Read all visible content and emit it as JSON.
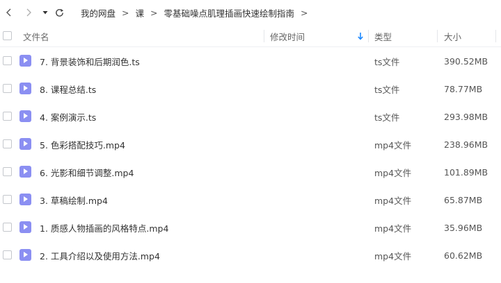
{
  "nav": {
    "breadcrumbs": [
      "我的网盘",
      "课",
      "零基础噪点肌理插画快速绘制指南"
    ]
  },
  "columns": {
    "name": "文件名",
    "modified": "修改时间",
    "type": "类型",
    "size": "大小",
    "sort_icon": "arrow-down-icon"
  },
  "files": [
    {
      "name": "7. 背景装饰和后期润色.ts",
      "type": "ts文件",
      "size": "390.52MB"
    },
    {
      "name": "8. 课程总结.ts",
      "type": "ts文件",
      "size": "78.77MB"
    },
    {
      "name": "4. 案例演示.ts",
      "type": "ts文件",
      "size": "293.98MB"
    },
    {
      "name": "5. 色彩搭配技巧.mp4",
      "type": "mp4文件",
      "size": "238.96MB"
    },
    {
      "name": "6. 光影和细节调整.mp4",
      "type": "mp4文件",
      "size": "101.89MB"
    },
    {
      "name": "3. 草稿绘制.mp4",
      "type": "mp4文件",
      "size": "65.87MB"
    },
    {
      "name": "1. 质感人物插画的风格特点.mp4",
      "type": "mp4文件",
      "size": "35.96MB"
    },
    {
      "name": "2. 工具介绍以及使用方法.mp4",
      "type": "mp4文件",
      "size": "60.62MB"
    }
  ],
  "colors": {
    "accent": "#1a88ff",
    "file_icon": "#8b8ff2"
  }
}
